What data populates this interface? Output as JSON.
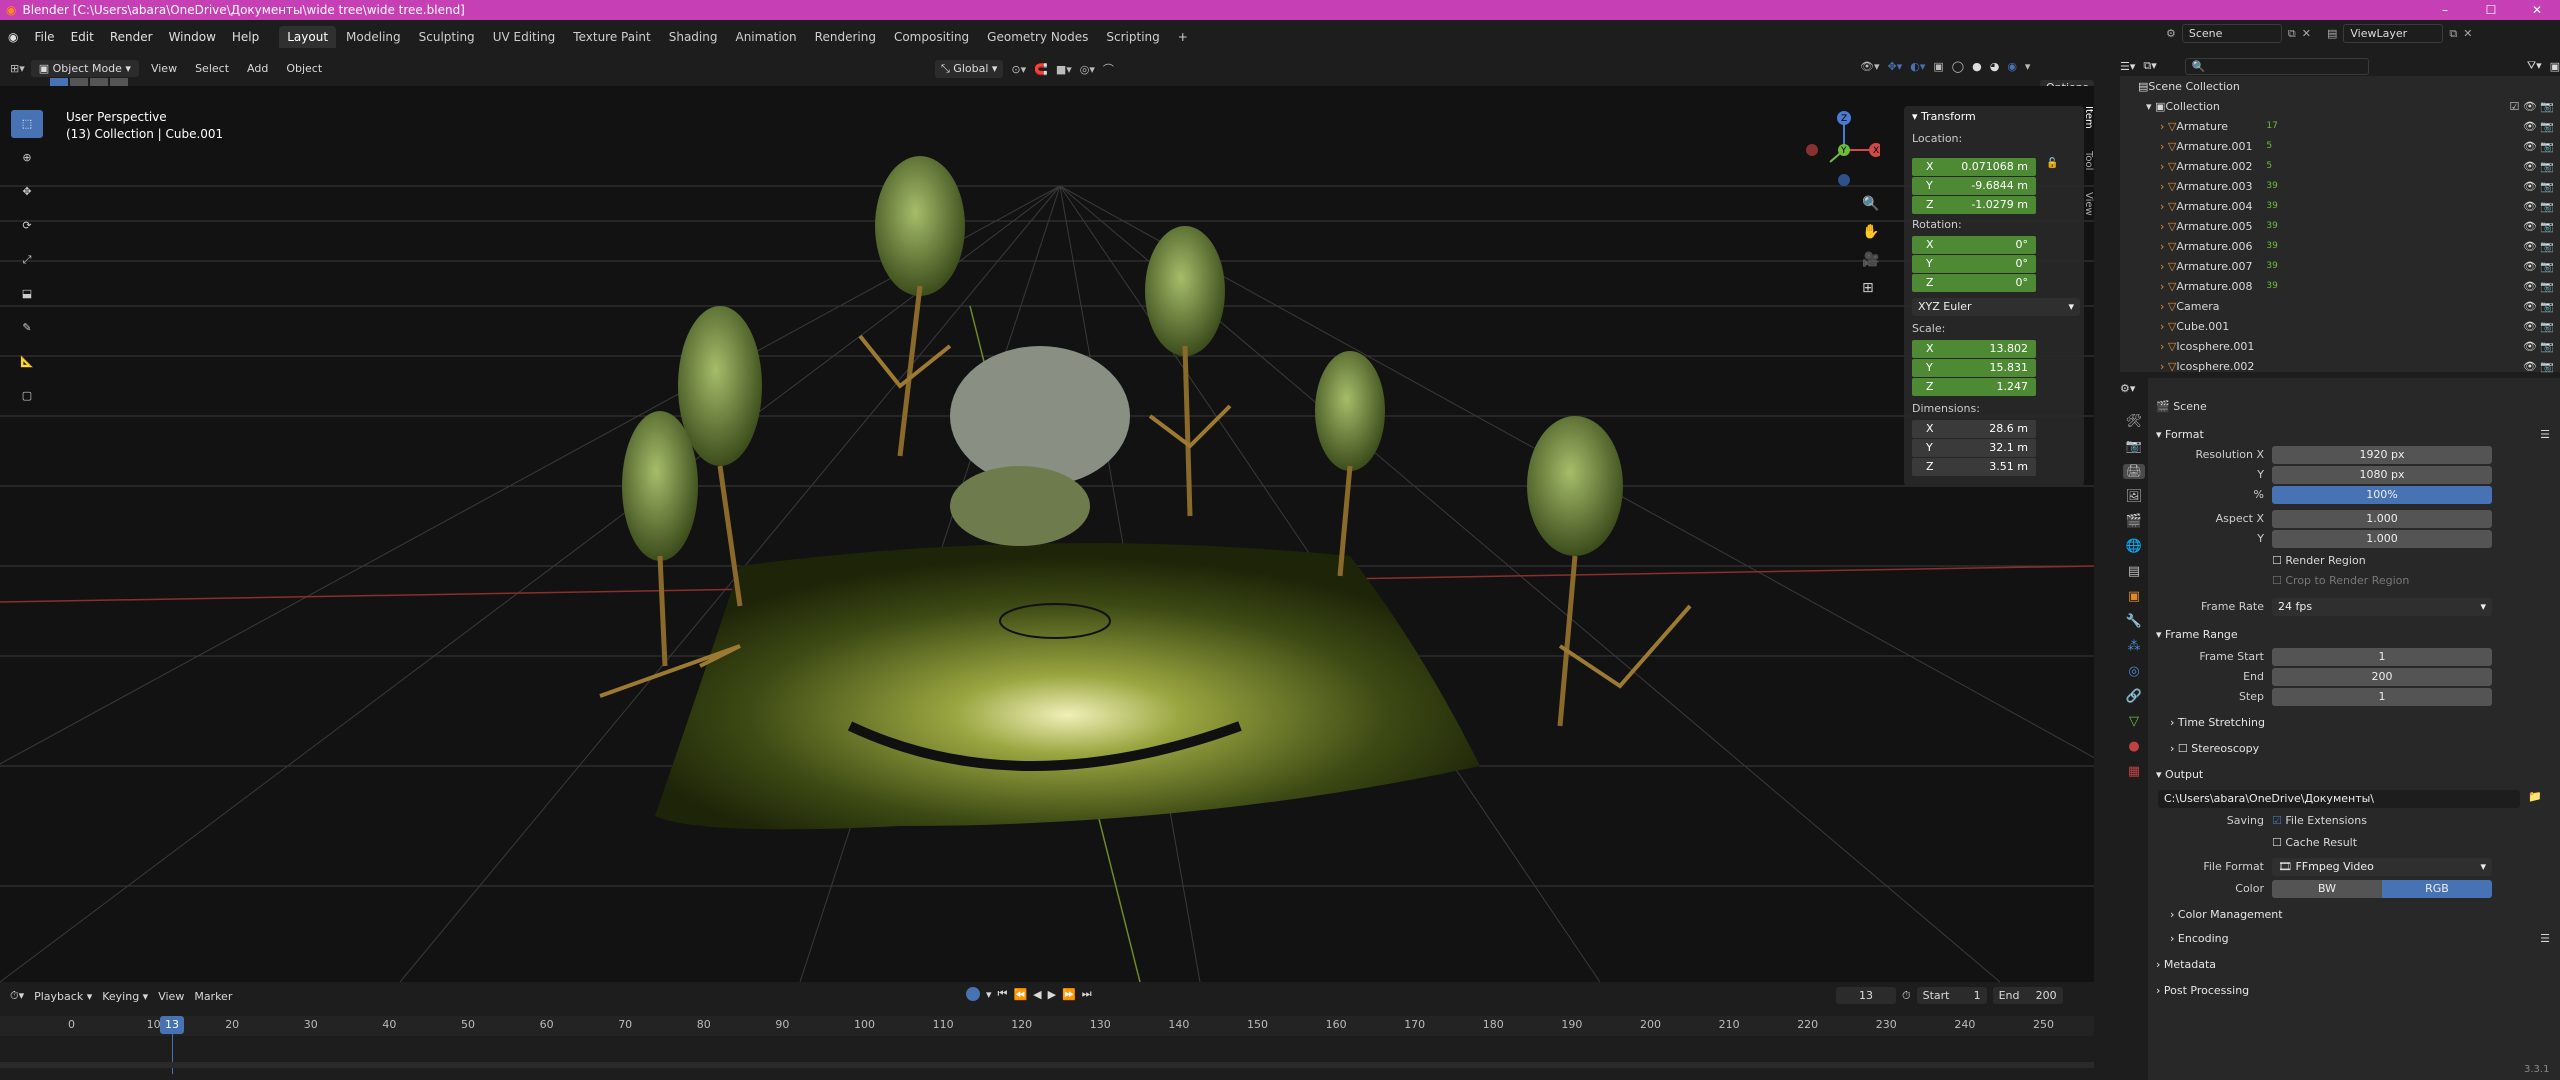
{
  "window": {
    "title": "Blender [C:\\Users\\abara\\OneDrive\\Документы\\wide tree\\wide tree.blend]",
    "controls": [
      "–",
      "☐",
      "✕"
    ]
  },
  "menu": [
    "File",
    "Edit",
    "Render",
    "Window",
    "Help"
  ],
  "workspaces": [
    "Layout",
    "Modeling",
    "Sculpting",
    "UV Editing",
    "Texture Paint",
    "Shading",
    "Animation",
    "Rendering",
    "Compositing",
    "Geometry Nodes",
    "Scripting",
    "+"
  ],
  "scene_selector": "Scene",
  "viewlayer_selector": "ViewLayer",
  "header": {
    "mode": "Object Mode",
    "view": "View",
    "select": "Select",
    "add": "Add",
    "object": "Object",
    "orientation": "Global",
    "options": "Options"
  },
  "viewport": {
    "perspective": "User Perspective",
    "collection": "(13) Collection | Cube.001"
  },
  "sidetabs": [
    "Item",
    "Tool",
    "View"
  ],
  "transform": {
    "title": "Transform",
    "location_label": "Location:",
    "location": [
      {
        "axis": "X",
        "value": "0.071068 m"
      },
      {
        "axis": "Y",
        "value": "-9.6844 m"
      },
      {
        "axis": "Z",
        "value": "-1.0279 m"
      }
    ],
    "rotation_label": "Rotation:",
    "rotation": [
      {
        "axis": "X",
        "value": "0°"
      },
      {
        "axis": "Y",
        "value": "0°"
      },
      {
        "axis": "Z",
        "value": "0°"
      }
    ],
    "rotation_mode": "XYZ Euler",
    "scale_label": "Scale:",
    "scale": [
      {
        "axis": "X",
        "value": "13.802"
      },
      {
        "axis": "Y",
        "value": "15.831"
      },
      {
        "axis": "Z",
        "value": "1.247"
      }
    ],
    "dimensions_label": "Dimensions:",
    "dimensions": [
      {
        "axis": "X",
        "value": "28.6 m"
      },
      {
        "axis": "Y",
        "value": "32.1 m"
      },
      {
        "axis": "Z",
        "value": "3.51 m"
      }
    ]
  },
  "outliner": {
    "scene_collection": "Scene Collection",
    "collection": "Collection",
    "items": [
      {
        "name": "Armature",
        "count": "17"
      },
      {
        "name": "Armature.001",
        "count": "5"
      },
      {
        "name": "Armature.002",
        "count": "5"
      },
      {
        "name": "Armature.003",
        "count": "39"
      },
      {
        "name": "Armature.004",
        "count": "39"
      },
      {
        "name": "Armature.005",
        "count": "39"
      },
      {
        "name": "Armature.006",
        "count": "39"
      },
      {
        "name": "Armature.007",
        "count": "39"
      },
      {
        "name": "Armature.008",
        "count": "39"
      },
      {
        "name": "Camera",
        "count": ""
      },
      {
        "name": "Cube.001",
        "count": ""
      },
      {
        "name": "Icosphere.001",
        "count": ""
      },
      {
        "name": "Icosphere.002",
        "count": ""
      }
    ]
  },
  "properties": {
    "scene": "Scene",
    "format_title": "Format",
    "resolution_x_label": "Resolution X",
    "resolution_x": "1920 px",
    "resolution_y_label": "Y",
    "resolution_y": "1080 px",
    "percent_label": "%",
    "percent": "100%",
    "aspect_x_label": "Aspect X",
    "aspect_x": "1.000",
    "aspect_y_label": "Y",
    "aspect_y": "1.000",
    "render_region": "Render Region",
    "crop_region": "Crop to Render Region",
    "frame_rate_label": "Frame Rate",
    "frame_rate": "24 fps",
    "frame_range_title": "Frame Range",
    "frame_start_label": "Frame Start",
    "frame_start": "1",
    "end_label": "End",
    "end": "200",
    "step_label": "Step",
    "step": "1",
    "time_stretching": "Time Stretching",
    "stereoscopy": "Stereoscopy",
    "output_title": "Output",
    "output_path": "C:\\Users\\abara\\OneDrive\\Документы\\",
    "saving_label": "Saving",
    "file_extensions": "File Extensions",
    "cache_result": "Cache Result",
    "file_format_label": "File Format",
    "file_format": "FFmpeg Video",
    "color_label": "Color",
    "color_bw": "BW",
    "color_rgb": "RGB",
    "color_management": "Color Management",
    "encoding": "Encoding",
    "metadata": "Metadata",
    "post_processing": "Post Processing"
  },
  "timeline": {
    "playback": "Playback",
    "keying": "Keying",
    "view": "View",
    "marker": "Marker",
    "current_frame": "13",
    "start_label": "Start",
    "start": "1",
    "end_label": "End",
    "end": "200",
    "ticks": [
      "0",
      "10",
      "20",
      "30",
      "40",
      "50",
      "60",
      "70",
      "80",
      "90",
      "100",
      "110",
      "120",
      "130",
      "140",
      "150",
      "160",
      "170",
      "180",
      "190",
      "200",
      "210",
      "220",
      "230",
      "240",
      "250"
    ],
    "playhead": "13"
  },
  "version": "3.3.1",
  "colors": {
    "accent": "#4772b3",
    "titlebar": "#c63fb4",
    "field_green": "#4e8a34"
  }
}
